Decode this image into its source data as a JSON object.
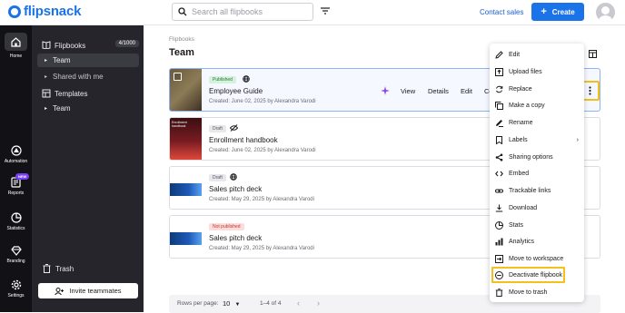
{
  "app": {
    "logo_text": "flipsnack",
    "brand_color": "#1a73e8"
  },
  "topbar": {
    "search_placeholder": "Search all flipbooks",
    "contact_label": "Contact sales",
    "create_label": "Create"
  },
  "rail": {
    "items": [
      {
        "label": "Home",
        "icon": "home-icon"
      },
      {
        "label": "Automation",
        "icon": "automation-icon"
      },
      {
        "label": "Reports",
        "icon": "reports-icon",
        "badge": "NEW"
      },
      {
        "label": "Statistics",
        "icon": "statistics-icon"
      },
      {
        "label": "Branding",
        "icon": "branding-icon"
      },
      {
        "label": "Settings",
        "icon": "settings-icon"
      }
    ]
  },
  "sidebar": {
    "flipbooks_label": "Flipbooks",
    "flipbooks_count": "4/1000",
    "team_label": "Team",
    "shared_label": "Shared with me",
    "templates_label": "Templates",
    "templates_team_label": "Team",
    "trash_label": "Trash",
    "invite_label": "Invite teammates"
  },
  "main": {
    "breadcrumb": "Flipbooks",
    "title": "Team",
    "cards": [
      {
        "status": "Published",
        "title": "Employee Guide",
        "meta": "Created: June 02, 2025 by Alexandra Varodi",
        "actions": [
          "View",
          "Details",
          "Edit",
          "Co"
        ]
      },
      {
        "status": "Draft",
        "title": "Enrollment handbook",
        "meta": "Created: June 02, 2025 by Alexandra Varodi",
        "thumb_text": "Enrollment handbook"
      },
      {
        "status": "Draft",
        "title": "Sales pitch deck",
        "meta": "Created: May 29, 2025 by Alexandra Varodi"
      },
      {
        "status": "Not published",
        "title": "Sales pitch deck",
        "meta": "Created: May 29, 2025 by Alexandra Varodi"
      }
    ],
    "pager": {
      "rows_label": "Rows per page:",
      "rows_value": "10",
      "range": "1–4 of 4"
    }
  },
  "menu": {
    "items": [
      {
        "label": "Edit",
        "icon": "pencil-icon"
      },
      {
        "label": "Upload files",
        "icon": "upload-icon"
      },
      {
        "label": "Replace",
        "icon": "replace-icon"
      },
      {
        "label": "Make a copy",
        "icon": "copy-icon"
      },
      {
        "label": "Rename",
        "icon": "rename-icon"
      },
      {
        "label": "Labels",
        "icon": "label-icon"
      },
      {
        "label": "Sharing options",
        "icon": "share-icon"
      },
      {
        "label": "Embed",
        "icon": "embed-icon"
      },
      {
        "label": "Trackable links",
        "icon": "link-icon"
      },
      {
        "label": "Download",
        "icon": "download-icon"
      },
      {
        "label": "Stats",
        "icon": "stats-icon"
      },
      {
        "label": "Analytics",
        "icon": "analytics-icon"
      },
      {
        "label": "Move to workspace",
        "icon": "workspace-icon"
      },
      {
        "label": "Deactivate flipbook",
        "icon": "deactivate-icon"
      },
      {
        "label": "Move to trash",
        "icon": "trash-icon"
      }
    ]
  },
  "colors": {
    "highlight": "#f4c01e",
    "accent": "#1a73e8",
    "sidebar": "#25252b",
    "rail": "#121216"
  }
}
